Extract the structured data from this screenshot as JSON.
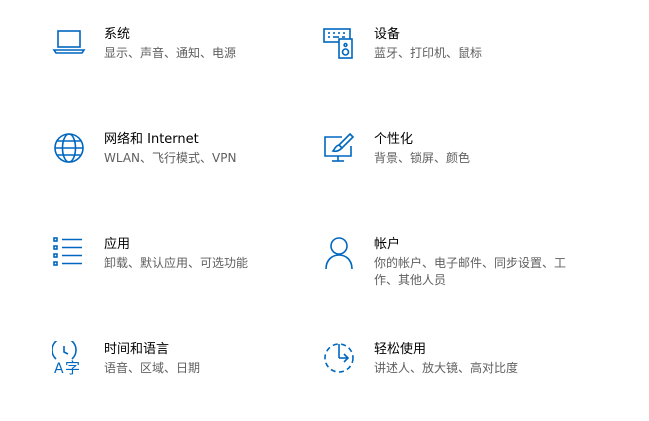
{
  "accent_color": "#0067c0",
  "tiles": [
    {
      "title": "系统",
      "desc": "显示、声音、通知、电源",
      "icon": "laptop-icon"
    },
    {
      "title": "设备",
      "desc": "蓝牙、打印机、鼠标",
      "icon": "keyboard-speaker-icon"
    },
    {
      "title": "网络和 Internet",
      "desc": "WLAN、飞行模式、VPN",
      "icon": "globe-icon"
    },
    {
      "title": "个性化",
      "desc": "背景、锁屏、颜色",
      "icon": "paint-monitor-icon"
    },
    {
      "title": "应用",
      "desc": "卸载、默认应用、可选功能",
      "icon": "app-list-icon"
    },
    {
      "title": "帐户",
      "desc": "你的帐户、电子邮件、同步设置、工作、其他人员",
      "icon": "person-icon"
    },
    {
      "title": "时间和语言",
      "desc": "语音、区域、日期",
      "icon": "time-language-icon"
    },
    {
      "title": "轻松使用",
      "desc": "讲述人、放大镜、高对比度",
      "icon": "ease-of-access-icon"
    }
  ]
}
